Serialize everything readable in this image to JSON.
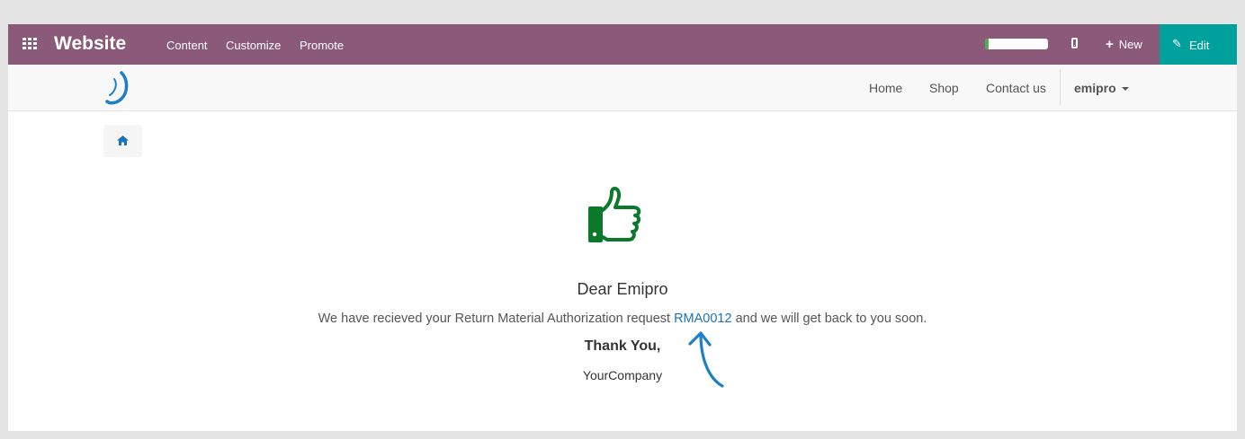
{
  "topbar": {
    "brand": "Website",
    "menu": [
      "Content",
      "Customize",
      "Promote"
    ],
    "progress": 0.06,
    "new_label": "New",
    "edit_label": "Edit",
    "colors": {
      "bar": "#8b5a78",
      "edit": "#00a09d"
    }
  },
  "navbar": {
    "links": [
      "Home",
      "Shop",
      "Contact us"
    ],
    "user": "emipro"
  },
  "icons": {
    "apps": "apps-grid-icon",
    "mobile": "mobile-icon",
    "plus": "plus-icon",
    "pencil": "pencil-icon",
    "home": "home-icon",
    "thumb": "thumbs-up-icon",
    "arrow": "curved-arrow-icon"
  },
  "content": {
    "greeting": "Dear Emipro",
    "message_before": "We have recieved your Return Material Authorization request ",
    "rma_number": "RMA0012",
    "message_after": " and we will get back to you soon.",
    "thanks": "Thank You,",
    "company": "YourCompany"
  }
}
